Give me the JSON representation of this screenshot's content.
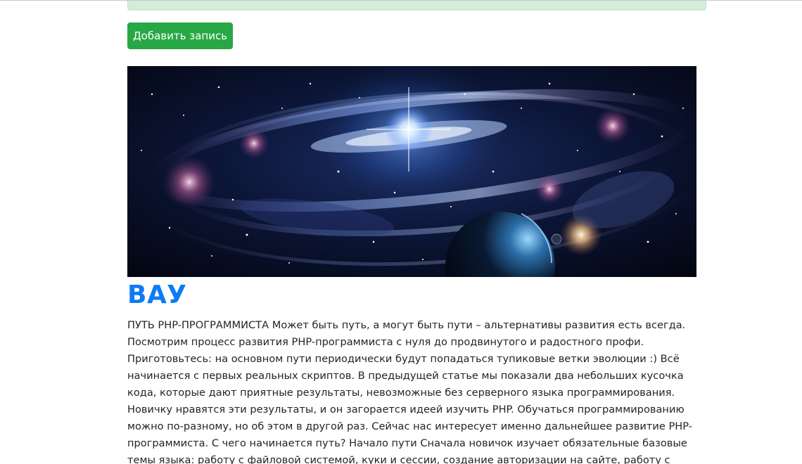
{
  "toolbar": {
    "add_record_label": "Добавить запись"
  },
  "post": {
    "title": "ВАУ",
    "image_alt": "",
    "body": "ПУТЬ PHP-ПРОГРАММИСТА Может быть путь, а могут быть пути – альтернативы развития есть всегда. Посмотрим процесс развития PHP-программиста с нуля до продвинутого и радостного профи. Приготовьтесь: на основном пути периодически будут попадаться тупиковые ветки эволюции :) Всё начинается с первых реальных скриптов. В предыдущей статье мы показали два небольших кусочка кода, которые дают приятные результаты, невозможные без серверного языка программирования. Новичку нравятся эти результаты, и он загорается идеей изучить PHP. Обучаться программированию можно по-разному, но об этом в другой раз. Сейчас нас интересует именно дальнейшее развитие PHP-программиста. С чего начинается путь? Начало пути Сначала новичок изучает обязательные базовые темы языка: работу с файловой системой, куки и сессии, создание авторизации на сайте, работу с базами данных - и начинает называть себя Junior'ом. На самом деле"
  },
  "colors": {
    "button_green": "#28a745",
    "alert_green": "#d4edda",
    "title_blue": "#0d7bf5",
    "text": "#212529"
  }
}
